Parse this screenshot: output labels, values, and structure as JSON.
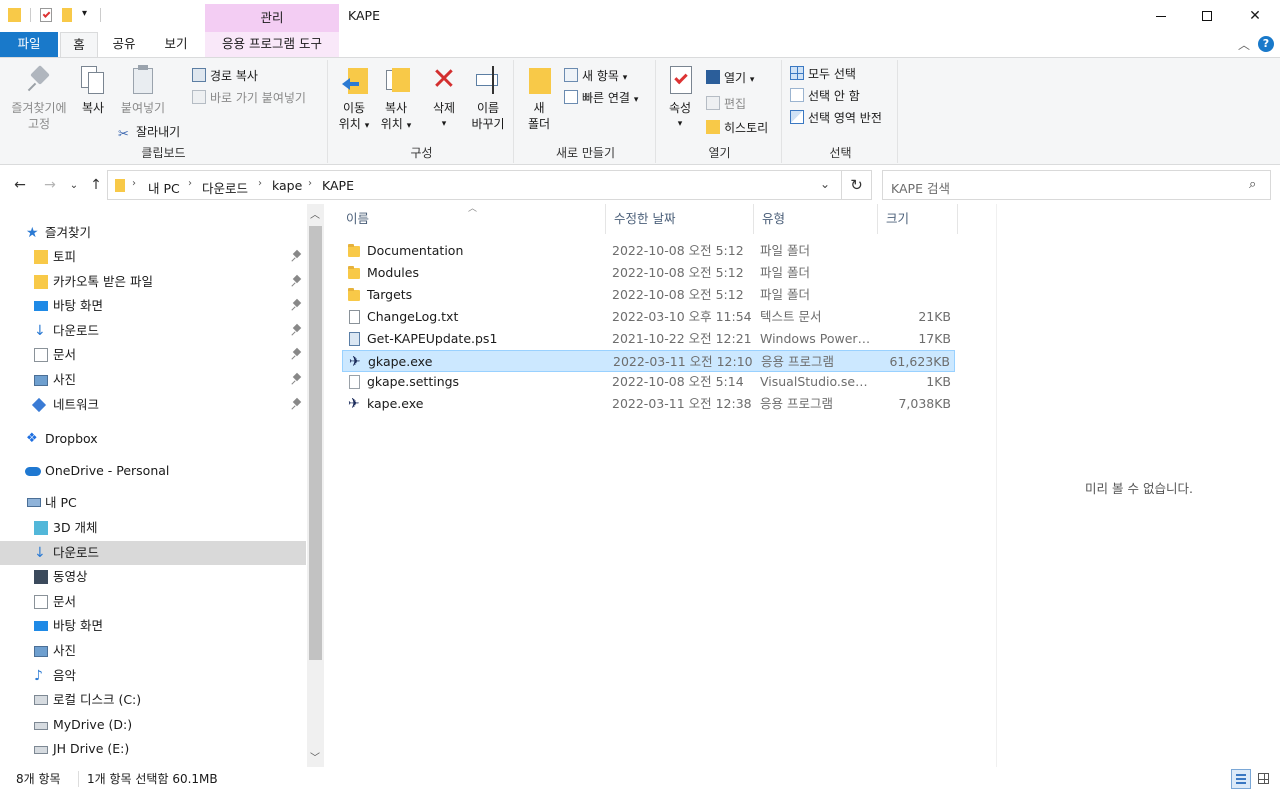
{
  "window": {
    "title": "KAPE",
    "contextual_tab_group": "관리",
    "controls": {
      "minimize": "—",
      "maximize": "☐",
      "close": "✕"
    }
  },
  "ribbon_tabs": [
    {
      "label": "파일",
      "state": "file"
    },
    {
      "label": "홈",
      "state": "active"
    },
    {
      "label": "공유",
      "state": "normal"
    },
    {
      "label": "보기",
      "state": "normal"
    },
    {
      "label": "응용 프로그램 도구",
      "state": "contextual"
    }
  ],
  "ribbon": {
    "clipboard": {
      "group_label": "클립보드",
      "pin_label_1": "즐겨찾기에",
      "pin_label_2": "고정",
      "copy_label": "복사",
      "paste_label": "붙여넣기",
      "copy_path_label": "경로 복사",
      "paste_shortcut_label": "바로 가기 붙여넣기",
      "cut_label": "잘라내기"
    },
    "organize": {
      "group_label": "구성",
      "move_label_1": "이동",
      "move_label_2": "위치",
      "copyto_label_1": "복사",
      "copyto_label_2": "위치",
      "delete_label": "삭제",
      "rename_label_1": "이름",
      "rename_label_2": "바꾸기"
    },
    "new": {
      "group_label": "새로 만들기",
      "new_folder_label_1": "새",
      "new_folder_label_2": "폴더",
      "new_item_label": "새 항목",
      "easy_access_label": "빠른 연결"
    },
    "open": {
      "group_label": "열기",
      "properties_label": "속성",
      "open_label": "열기",
      "edit_label": "편집",
      "history_label": "히스토리"
    },
    "select": {
      "group_label": "선택",
      "select_all_label": "모두 선택",
      "select_none_label": "선택 안 함",
      "invert_label": "선택 영역 반전"
    }
  },
  "address": {
    "crumbs": [
      "내 PC",
      "다운로드",
      "kape",
      "KAPE"
    ],
    "search_placeholder": "KAPE 검색"
  },
  "nav": {
    "quick_access_label": "즐겨찾기",
    "quick_items": [
      {
        "label": "토피",
        "icon": "folder-icon"
      },
      {
        "label": "카카오톡 받은 파일",
        "icon": "folder-icon"
      },
      {
        "label": "바탕 화면",
        "icon": "desktop-icon"
      },
      {
        "label": "다운로드",
        "icon": "download-icon"
      },
      {
        "label": "문서",
        "icon": "document-icon"
      },
      {
        "label": "사진",
        "icon": "pictures-icon"
      },
      {
        "label": "네트워크",
        "icon": "network-icon"
      }
    ],
    "dropbox_label": "Dropbox",
    "onedrive_label": "OneDrive - Personal",
    "thispc_label": "내 PC",
    "pc_items": [
      {
        "label": "3D 개체",
        "icon": "3d-objects-icon"
      },
      {
        "label": "다운로드",
        "icon": "download-icon"
      },
      {
        "label": "동영상",
        "icon": "videos-icon"
      },
      {
        "label": "문서",
        "icon": "document-icon"
      },
      {
        "label": "바탕 화면",
        "icon": "desktop-icon"
      },
      {
        "label": "사진",
        "icon": "pictures-icon"
      },
      {
        "label": "음악",
        "icon": "music-icon"
      },
      {
        "label": "로컬 디스크 (C:)",
        "icon": "drive-c-icon"
      },
      {
        "label": "MyDrive (D:)",
        "icon": "drive-icon"
      },
      {
        "label": "JH Drive (E:)",
        "icon": "drive-icon"
      }
    ],
    "selected_pc_item": "다운로드"
  },
  "columns": {
    "name": "이름",
    "date": "수정한 날짜",
    "type": "유형",
    "size": "크기"
  },
  "files": [
    {
      "name": "Documentation",
      "date": "2022-10-08 오전 5:12",
      "type": "파일 폴더",
      "size": "",
      "icon": "folder-icon"
    },
    {
      "name": "Modules",
      "date": "2022-10-08 오전 5:12",
      "type": "파일 폴더",
      "size": "",
      "icon": "folder-icon"
    },
    {
      "name": "Targets",
      "date": "2022-10-08 오전 5:12",
      "type": "파일 폴더",
      "size": "",
      "icon": "folder-icon"
    },
    {
      "name": "ChangeLog.txt",
      "date": "2022-03-10 오후 11:54",
      "type": "텍스트 문서",
      "size": "21KB",
      "icon": "text-file-icon"
    },
    {
      "name": "Get-KAPEUpdate.ps1",
      "date": "2021-10-22 오전 12:21",
      "type": "Windows PowerS...",
      "size": "17KB",
      "icon": "powershell-file-icon"
    },
    {
      "name": "gkape.exe",
      "date": "2022-03-11 오전 12:10",
      "type": "응용 프로그램",
      "size": "61,623KB",
      "icon": "app-icon",
      "selected": true
    },
    {
      "name": "gkape.settings",
      "date": "2022-10-08 오전 5:14",
      "type": "VisualStudio.settin...",
      "size": "1KB",
      "icon": "blank-file-icon"
    },
    {
      "name": "kape.exe",
      "date": "2022-03-11 오전 12:38",
      "type": "응용 프로그램",
      "size": "7,038KB",
      "icon": "app-icon"
    }
  ],
  "preview": {
    "message": "미리 볼 수 없습니다."
  },
  "status": {
    "item_count": "8개 항목",
    "selection": "1개 항목 선택함 60.1MB"
  }
}
